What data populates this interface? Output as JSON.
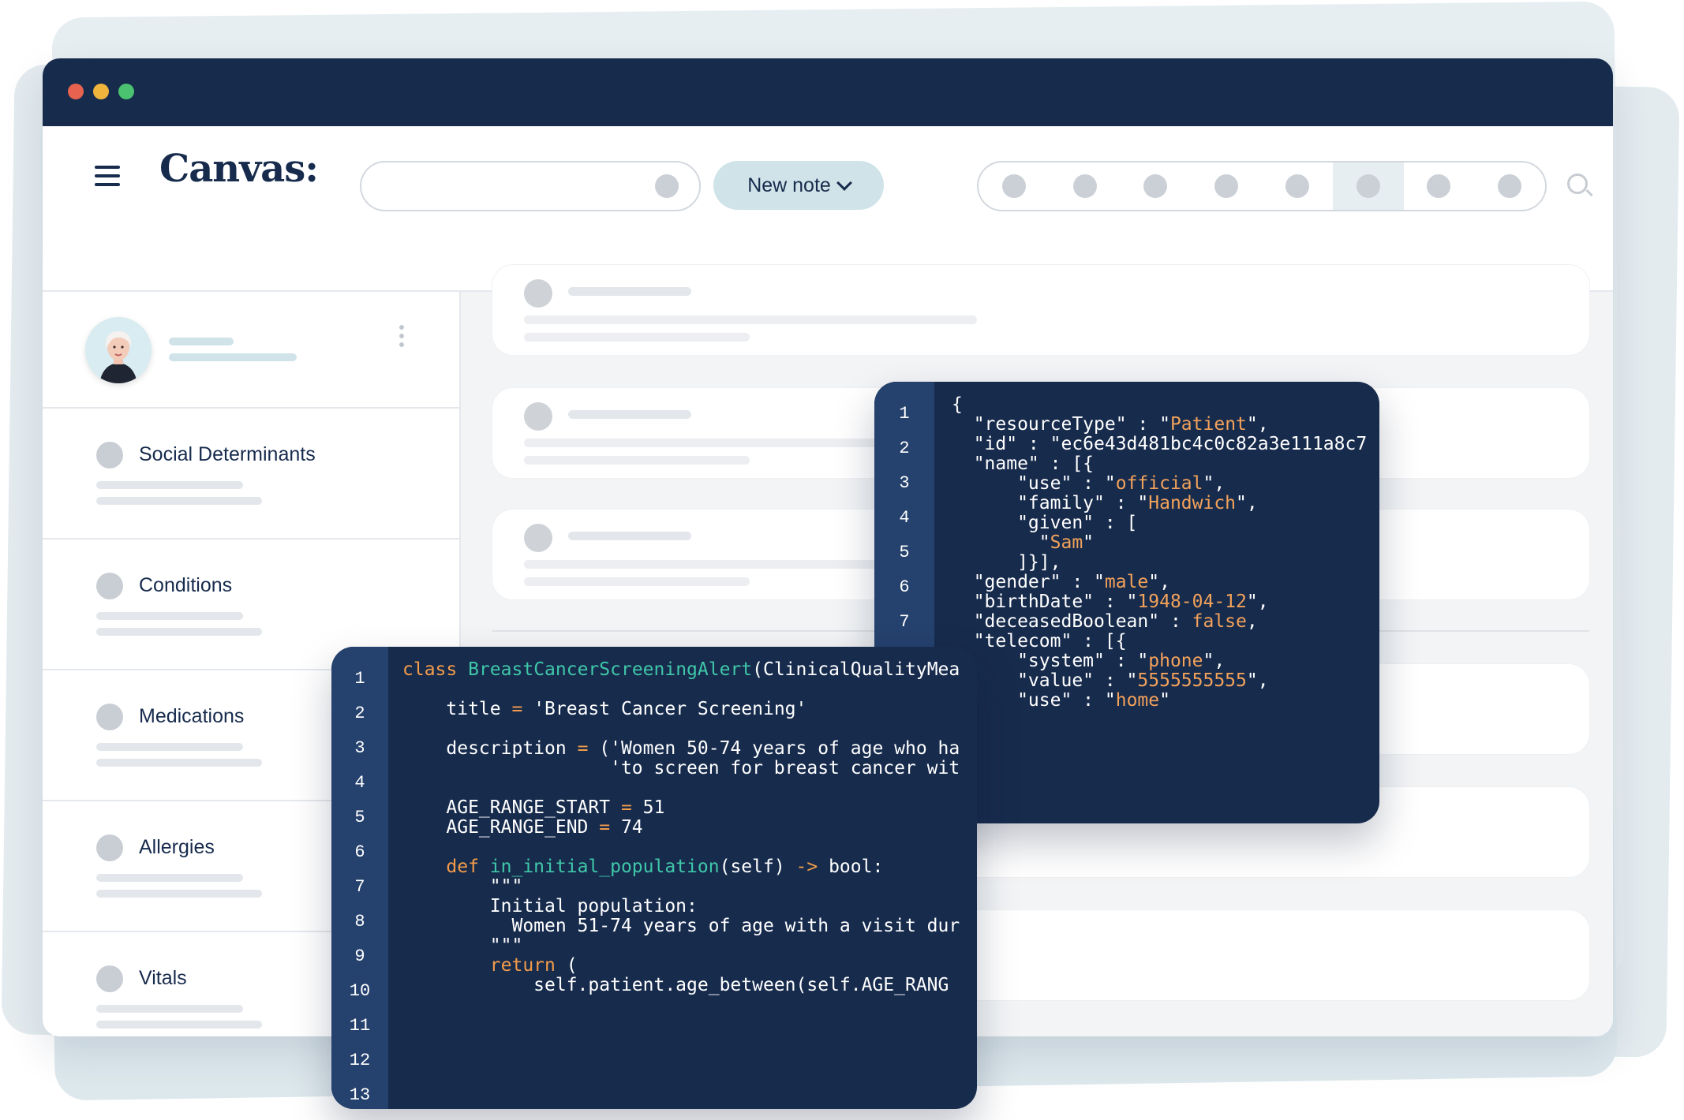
{
  "window": {
    "traffic_lights": [
      "#e8634f",
      "#f0b43c",
      "#4bc26f"
    ]
  },
  "header": {
    "logo": "Canvas:",
    "new_note_label": "New note",
    "menu_icon": "hamburger-icon",
    "search_icon": "magnifier-icon"
  },
  "sidebar": {
    "sections": [
      {
        "label": "Social Determinants"
      },
      {
        "label": "Conditions"
      },
      {
        "label": "Medications"
      },
      {
        "label": "Allergies"
      },
      {
        "label": "Vitals"
      }
    ]
  },
  "json_panel": {
    "line_numbers": [
      "1",
      "2",
      "3",
      "4",
      "5",
      "6",
      "7"
    ],
    "lines": [
      "{",
      "  \"resourceType\" : \"Patient\",",
      "  \"id\" : \"ec6e43d481bc4c0c82a3e111a8c7",
      "  \"name\" : [{",
      "      \"use\" : \"official\",",
      "      \"family\" : \"Handwich\",",
      "      \"given\" : [",
      "        \"Sam\"",
      "      ]}],",
      "  \"gender\" : \"male\",",
      "  \"birthDate\" : \"1948-04-12\",",
      "  \"deceasedBoolean\" : false,",
      "  \"telecom\" : [{",
      "      \"system\" : \"phone\",",
      "      \"value\" : \"5555555555\",",
      "      \"use\" : \"home\""
    ]
  },
  "python_panel": {
    "line_numbers": [
      "1",
      "2",
      "3",
      "4",
      "5",
      "6",
      "7",
      "8",
      "9",
      "10",
      "11",
      "12",
      "13"
    ],
    "lines": [
      "class BreastCancerScreeningAlert(ClinicalQualityMea",
      "",
      "    title = 'Breast Cancer Screening'",
      "",
      "    description = ('Women 50-74 years of age who ha",
      "                   'to screen for breast cancer wit",
      "",
      "    AGE_RANGE_START = 51",
      "    AGE_RANGE_END = 74",
      "",
      "    def in_initial_population(self) -> bool:",
      "        \"\"\"",
      "        Initial population:",
      "          Women 51-74 years of age with a visit dur",
      "        \"\"\"",
      "        return (",
      "            self.patient.age_between(self.AGE_RANG"
    ]
  }
}
